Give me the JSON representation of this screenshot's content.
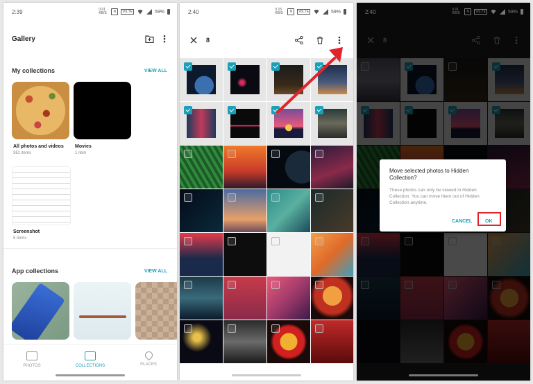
{
  "status_bars": [
    {
      "time": "2:39",
      "net": "0.01 KB/S",
      "lte": "VoLTE",
      "battery": "59%"
    },
    {
      "time": "2:40",
      "net": "0.15 KB/S",
      "lte": "VoLTE",
      "battery": "59%"
    },
    {
      "time": "2:40",
      "net": "0.01 KB/S",
      "lte": "VoLTE",
      "battery": "59%"
    }
  ],
  "gallery": {
    "title": "Gallery",
    "my_collections": "My collections",
    "view_all": "VIEW ALL",
    "collections": [
      {
        "name": "All photos and videos",
        "count": "361 items"
      },
      {
        "name": "Movies",
        "count": "1 item"
      },
      {
        "name": "Screenshot",
        "count": "5 items"
      }
    ],
    "app_collections": "App collections",
    "app_view_all": "VIEW ALL",
    "nav": {
      "photos": "PHOTOS",
      "collections": "COLLECTIONS",
      "places": "PLACES"
    }
  },
  "selection": {
    "count": "8"
  },
  "dialog": {
    "title": "Move selected photos to Hidden Collection?",
    "message": "These photos can only be viewed in Hidden Collection. You can move them out of Hidden Collection anytime.",
    "cancel": "CANCEL",
    "ok": "OK"
  },
  "colors": {
    "accent": "#1aa0b8",
    "highlight": "#e0242a"
  }
}
